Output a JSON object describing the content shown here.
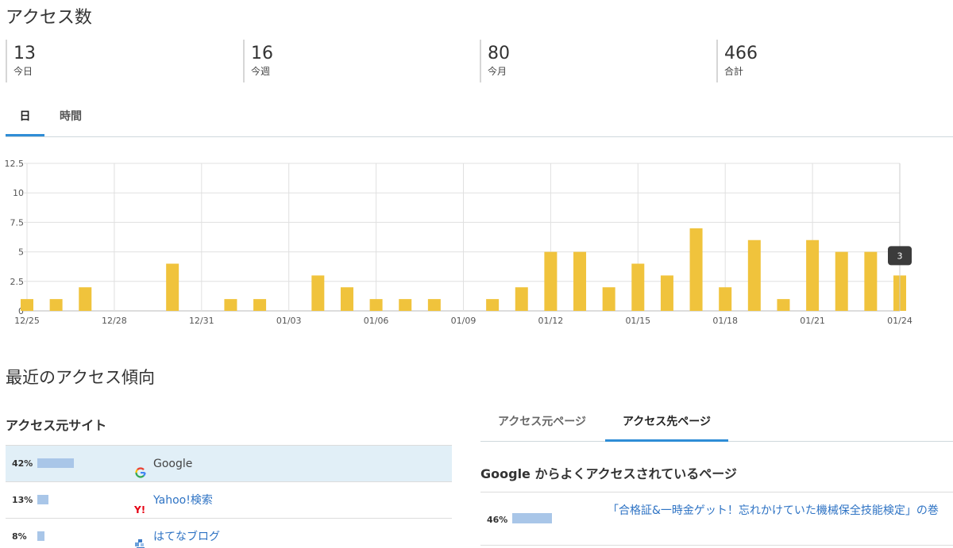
{
  "title": "アクセス数",
  "stats": [
    {
      "value": "13",
      "label": "今日"
    },
    {
      "value": "16",
      "label": "今週"
    },
    {
      "value": "80",
      "label": "今月"
    },
    {
      "value": "466",
      "label": "合計"
    }
  ],
  "tabs": [
    {
      "label": "日",
      "active": true
    },
    {
      "label": "時間",
      "active": false
    }
  ],
  "chart_data": {
    "type": "bar",
    "categories": [
      "12/25",
      "12/26",
      "12/27",
      "12/28",
      "12/29",
      "12/30",
      "12/31",
      "01/01",
      "01/02",
      "01/03",
      "01/04",
      "01/05",
      "01/06",
      "01/07",
      "01/08",
      "01/09",
      "01/10",
      "01/11",
      "01/12",
      "01/13",
      "01/14",
      "01/15",
      "01/16",
      "01/17",
      "01/18",
      "01/19",
      "01/20",
      "01/21",
      "01/22",
      "01/23",
      "01/24"
    ],
    "values": [
      1,
      1,
      2,
      0,
      0,
      4,
      0,
      1,
      1,
      0,
      3,
      2,
      1,
      1,
      1,
      0,
      1,
      2,
      5,
      5,
      2,
      4,
      3,
      7,
      2,
      6,
      1,
      6,
      5,
      5,
      3
    ],
    "x_tick_labels": [
      "12/25",
      "12/28",
      "12/31",
      "01/03",
      "01/06",
      "01/09",
      "01/12",
      "01/15",
      "01/18",
      "01/21",
      "01/24"
    ],
    "y_ticks": [
      "0",
      "2.5",
      "5",
      "7.5",
      "10",
      "12.5"
    ],
    "ylim": [
      0,
      12.5
    ],
    "bar_color": "#f0c33c",
    "grid": true,
    "tooltip": {
      "category": "01/24",
      "value": "3"
    }
  },
  "trend_title": "最近のアクセス傾向",
  "referrers": {
    "title": "アクセス元サイト",
    "items": [
      {
        "pct": "42%",
        "value": 42,
        "name": "Google",
        "icon": "google-icon",
        "link": false
      },
      {
        "pct": "13%",
        "value": 13,
        "name": "Yahoo!検索",
        "icon": "yahoo-icon",
        "link": true
      },
      {
        "pct": "8%",
        "value": 8,
        "name": "はてなブログ",
        "icon": "hatena-blog-icon",
        "link": true
      }
    ]
  },
  "page_tabs": [
    {
      "label": "アクセス元ページ",
      "active": false
    },
    {
      "label": "アクセス先ページ",
      "active": true
    }
  ],
  "pages": {
    "title": "Google からよくアクセスされているページ",
    "items": [
      {
        "pct": "46%",
        "value": 46,
        "title": "「合格証&一時金ゲット！忘れかけていた機械保全技能検定」の巻"
      }
    ]
  }
}
